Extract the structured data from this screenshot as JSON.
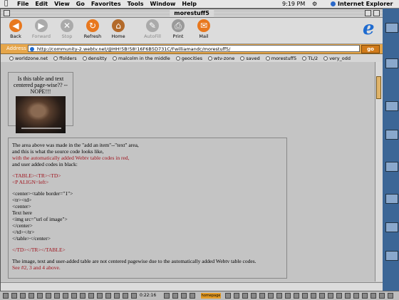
{
  "menubar": {
    "apple": "",
    "items": [
      "File",
      "Edit",
      "View",
      "Go",
      "Favorites",
      "Tools",
      "Window",
      "Help"
    ],
    "clock": "9:19 PM",
    "app_name": "Internet Explorer"
  },
  "window": {
    "title": "morestuff5"
  },
  "toolbar": {
    "back": "Back",
    "forward": "Forward",
    "stop": "Stop",
    "refresh": "Refresh",
    "home": "Home",
    "autofill": "AutoFill",
    "print": "Print",
    "mail": "Mail",
    "back_glyph": "◀",
    "forward_glyph": "▶",
    "stop_glyph": "✕",
    "refresh_glyph": "↻",
    "home_glyph": "⌂",
    "autofill_glyph": "✎",
    "print_glyph": "⎙",
    "mail_glyph": "✉",
    "ie_glyph": "e"
  },
  "address": {
    "label": "Address",
    "url": "http://community-2.webtv.net/@HH!5B!58!16F6B5D731C/Fwilliamandc/morestuff5/",
    "go": "go"
  },
  "favorites": [
    "worldzone.net",
    "ffolders",
    "densitty",
    "malcolm in the middle",
    "geocities",
    "wtv-zone",
    "saved",
    "morestuff5",
    "TL/2",
    "very_odd"
  ],
  "content": {
    "box1_text": "Is this table and text centered page-wise?? -- NOPE!!!",
    "p1_line1": "The area above was made in the \"add an item\"--\"text\" area,",
    "p1_line2": "and this is what the source code looks like,",
    "p1_line3": "with the automatically added Webtv table codes in red,",
    "p1_line4": "and user added codes in black:",
    "red1": "<TABLE><TR><TD>",
    "red2": "<P ALIGN=left>",
    "code1": "<center><table border=\"1\">",
    "code2": "<tr><td>",
    "code3": "<center>",
    "code4": "Text here",
    "code5": "<img src=\"url of image\">",
    "code6": "</center>",
    "code7": "</td></tr>",
    "code8": "</table></center>",
    "red3": "</TD></TR></TABLE>",
    "p2_line1": "The image, text and user-added table are not centered pagewise due to the automatically added Webtv table codes.",
    "p2_line2": "See #2, 3 and 4 above."
  },
  "taskbar": {
    "time": "0:22:16",
    "orange_label": "homepage"
  }
}
